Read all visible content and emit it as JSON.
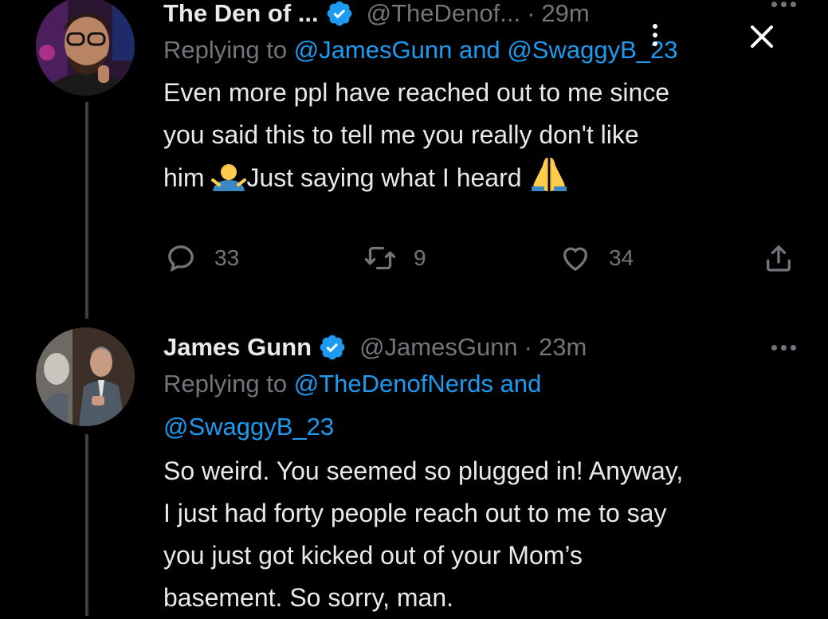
{
  "tweets": [
    {
      "display_name": "The Den of ...",
      "handle": "@TheDenof...",
      "separator": "·",
      "time": "29m",
      "reply_prefix": "Replying to",
      "reply_to_1": "@JamesGunn",
      "reply_and": "and",
      "reply_to_2": "@SwaggyB_23",
      "text_line_1": "Even more ppl have reached out to me since",
      "text_line_2": "you said this to tell me you really don't like",
      "text_line_3a": "him",
      "text_line_3b": "Just saying what I heard",
      "replies": "33",
      "retweets": "9",
      "likes": "34"
    },
    {
      "display_name": "James Gunn",
      "handle": "@JamesGunn",
      "separator": "·",
      "time": "23m",
      "reply_prefix": "Replying to",
      "reply_to_1": "@TheDenofNerds",
      "reply_and": "and",
      "reply_to_2": "@SwaggyB_23",
      "text_line_1": "So weird. You seemed so plugged in! Anyway,",
      "text_line_2": "I just had forty people reach out to me to say",
      "text_line_3": "you just got kicked out of your Mom’s",
      "text_line_4": "basement. So sorry, man."
    }
  ],
  "icons": {
    "verified": "verified-badge-icon",
    "more": "more-horizontal-icon",
    "reply": "reply-icon",
    "retweet": "retweet-icon",
    "like": "heart-icon",
    "share": "share-icon",
    "overlay_menu": "more-vertical-icon",
    "overlay_close": "close-icon"
  },
  "colors": {
    "background": "#000000",
    "text": "#e7e9ea",
    "secondary": "#71767b",
    "accent": "#1d9bf0",
    "thread_line": "#3e4144"
  }
}
